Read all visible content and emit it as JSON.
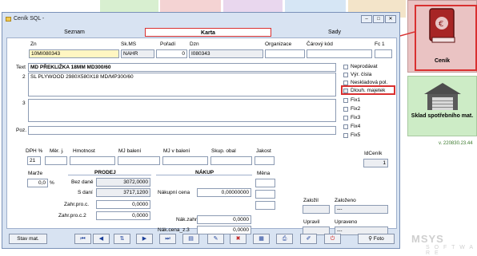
{
  "window": {
    "title": "Ceník SQL -",
    "buttons": [
      "‒",
      "□",
      "✕"
    ]
  },
  "background": {
    "tile_colors": [
      "#d8efd0",
      "#f4d3d3",
      "#e9d7ee",
      "#d6e6f5",
      "#f3e4c9"
    ],
    "cenik_label": "Ceník",
    "sklad_label": "Sklad spotřebního mat.",
    "version": "v. 220830.23.44",
    "logo_text": "MSYS",
    "logo_sub": "S O F T W A R E"
  },
  "tabs": [
    {
      "label": "Seznam"
    },
    {
      "label": "Karta"
    },
    {
      "label": "Sady"
    }
  ],
  "fields": {
    "zn_label": "Zn",
    "zn_value": "10MI080343",
    "skms_label": "Sk.MS",
    "skms_value": "NAHR",
    "poradi_label": "Pořadí",
    "poradi_value": "0",
    "dzn_label": "Dzn",
    "dzn_value": "I080343",
    "organizace_label": "Organizace",
    "organizace_value": "",
    "carovy_kod_label": "Čárový kód",
    "carovy_kod_value": "",
    "fc1_label": "Fc 1",
    "fc1_value": "",
    "text_label": "Text",
    "text_value": "MD PŘEKLIŽKA 18MM MD300/60",
    "line2_num": "2",
    "line2_value": "SL PLYWOOD 2980X580X18 MD/MP300/60",
    "line3_num": "3",
    "poz_label": "Poz."
  },
  "checkboxes": [
    {
      "label": "Neprodávat",
      "checked": false
    },
    {
      "label": "Výr. čísla",
      "checked": false
    },
    {
      "label": "Neskladová pol.",
      "checked": false
    },
    {
      "label": "Dlouh. majetek",
      "checked": false
    },
    {
      "label": "Fix1",
      "checked": false
    },
    {
      "label": "Fix2",
      "checked": false
    },
    {
      "label": "Fix3",
      "checked": false
    },
    {
      "label": "Fix4",
      "checked": false
    },
    {
      "label": "Fix5",
      "checked": false
    }
  ],
  "row2": {
    "dph_label": "DPH %",
    "dph_value": "21",
    "mer_label": "Měr. j.",
    "mer_value": "",
    "hmotnost_label": "Hmotnost",
    "hmotnost_value": "",
    "mj_baleni_label": "MJ balení",
    "mj_baleni_value": "",
    "mj_v_baleni_label": "MJ v balení",
    "mj_v_baleni_value": "",
    "skup_obal_label": "Skup. obal",
    "skup_obal_value": "",
    "jakost_label": "Jakost",
    "jakost_value": "",
    "idcenik_label": "IdCeník",
    "idcenik_value": "1"
  },
  "prodej": {
    "title": "PRODEJ",
    "marze_label": "Marže",
    "marze_value": "0,0",
    "marze_unit": "%",
    "bez_dane_label": "Bez daně",
    "bez_dane_value": "3072,0000",
    "s_dani_label": "S daní",
    "s_dani_value": "3717,1200",
    "zahr1_label": "Zahr.pro.c.",
    "zahr1_value": "0,0000",
    "zahr2_label": "Zahr.pro.c.2",
    "zahr2_value": "0,0000"
  },
  "nakup": {
    "title": "NÁKUP",
    "nakupni_label": "Nákupní cena",
    "nakupni_value": "0,00000000",
    "nak_zahr_label": "Nák.zahr.",
    "nak_zahr_value": "0,0000",
    "nak_cena_z3_label": "Nák.cena_z.3",
    "nak_cena_z3_value": "0,0000",
    "mena_label": "Měna"
  },
  "audit": {
    "zalozil_label": "Založil",
    "zalozeno_label": "Založeno",
    "zalozeno_value": "---",
    "upravil_label": "Upravil",
    "upraveno_label": "Upraveno",
    "upraveno_value": "---"
  },
  "toolbar": {
    "stav_mat": "Stav mat.",
    "nav": [
      "⏮",
      "◀",
      "⇅",
      "▶",
      "⏭",
      "▤",
      "✎",
      "✖",
      "▦",
      "⎙",
      "✐",
      "⏻"
    ],
    "foto": "Foto"
  }
}
